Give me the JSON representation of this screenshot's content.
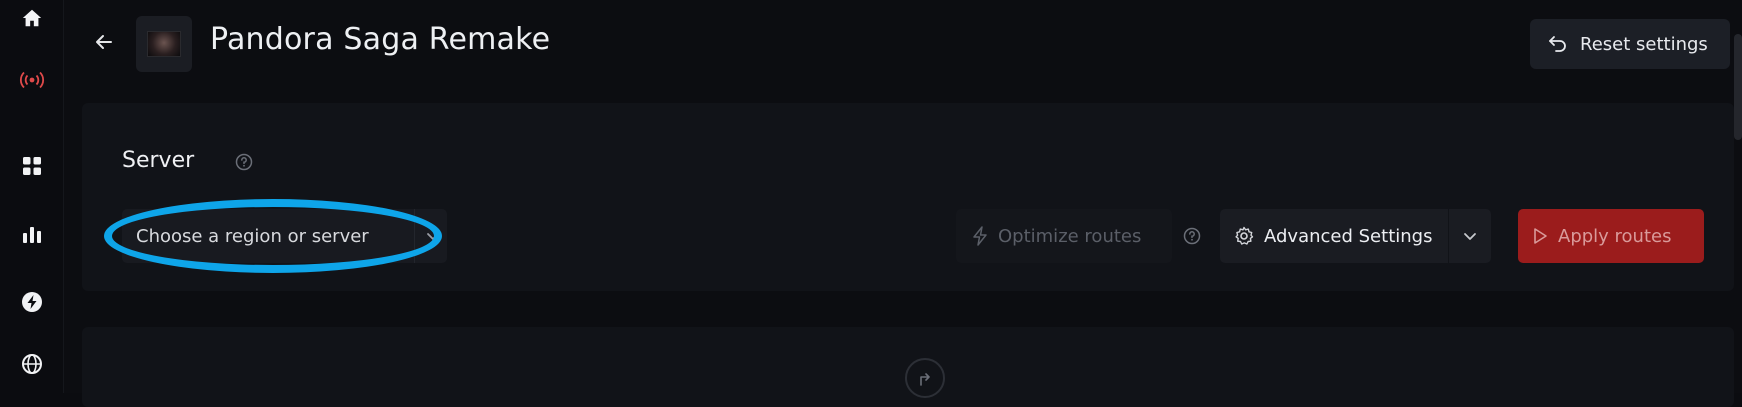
{
  "sidebar": {
    "items": [
      {
        "icon": "home-icon",
        "active": false
      },
      {
        "icon": "broadcast-icon",
        "active": true,
        "color": "#e04a4a"
      },
      {
        "icon": "grid-icon",
        "active": false
      },
      {
        "icon": "bar-chart-icon",
        "active": false
      },
      {
        "icon": "lightning-icon",
        "active": false
      },
      {
        "icon": "globe-icon",
        "active": false
      }
    ]
  },
  "header": {
    "title": "Pandora Saga Remake",
    "reset_label": "Reset settings"
  },
  "server": {
    "section_title": "Server",
    "region_placeholder": "Choose a region or server",
    "optimize_label": "Optimize routes",
    "advanced_label": "Advanced Settings",
    "apply_label": "Apply routes"
  },
  "colors": {
    "accent_red": "#9b1c1c",
    "highlight_blue": "#0ea5e9",
    "background": "#0c0d11"
  }
}
